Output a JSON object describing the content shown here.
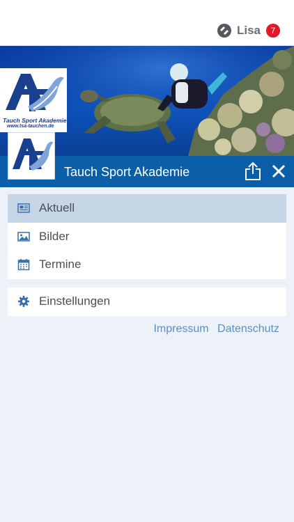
{
  "user": {
    "name": "Lisa",
    "badge_count": "7"
  },
  "logo": {
    "caption_name": "Tauch Sport Akademie",
    "caption_url": "www.tsa-tauchen.de"
  },
  "header": {
    "title": "Tauch Sport Akademie"
  },
  "menu": {
    "items": [
      {
        "label": "Aktuell",
        "icon": "newspaper-icon",
        "active": true
      },
      {
        "label": "Bilder",
        "icon": "image-icon",
        "active": false
      },
      {
        "label": "Termine",
        "icon": "calendar-icon",
        "active": false
      }
    ],
    "settings_label": "Einstellungen"
  },
  "footer": {
    "impressum": "Impressum",
    "datenschutz": "Datenschutz"
  },
  "colors": {
    "accent": "#0a5fa8",
    "active_item": "#c6d6e7",
    "badge": "#e0192a",
    "link": "#5f8ec0",
    "background": "#edf1f8"
  }
}
